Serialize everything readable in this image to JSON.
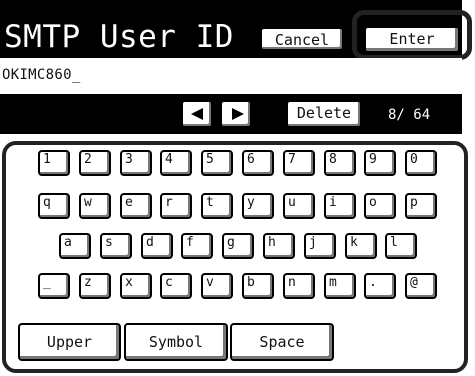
{
  "header": {
    "title": "SMTP User ID",
    "cancel_label": "Cancel",
    "enter_label": "Enter"
  },
  "input": {
    "value": "OKIMC860",
    "cursor": "_"
  },
  "navbar": {
    "left_arrow_icon": "left-arrow-icon",
    "right_arrow_icon": "right-arrow-icon",
    "delete_label": "Delete",
    "counter": "8/ 64"
  },
  "keyboard": {
    "row1": [
      "1",
      "2",
      "3",
      "4",
      "5",
      "6",
      "7",
      "8",
      "9",
      "0"
    ],
    "row2": [
      "q",
      "w",
      "e",
      "r",
      "t",
      "y",
      "u",
      "i",
      "o",
      "p"
    ],
    "row3": [
      "a",
      "s",
      "d",
      "f",
      "g",
      "h",
      "j",
      "k",
      "l"
    ],
    "row4": [
      "_",
      "z",
      "x",
      "c",
      "v",
      "b",
      "n",
      "m",
      ".",
      "@"
    ],
    "upper_label": "Upper",
    "symbol_label": "Symbol",
    "space_label": "Space"
  }
}
